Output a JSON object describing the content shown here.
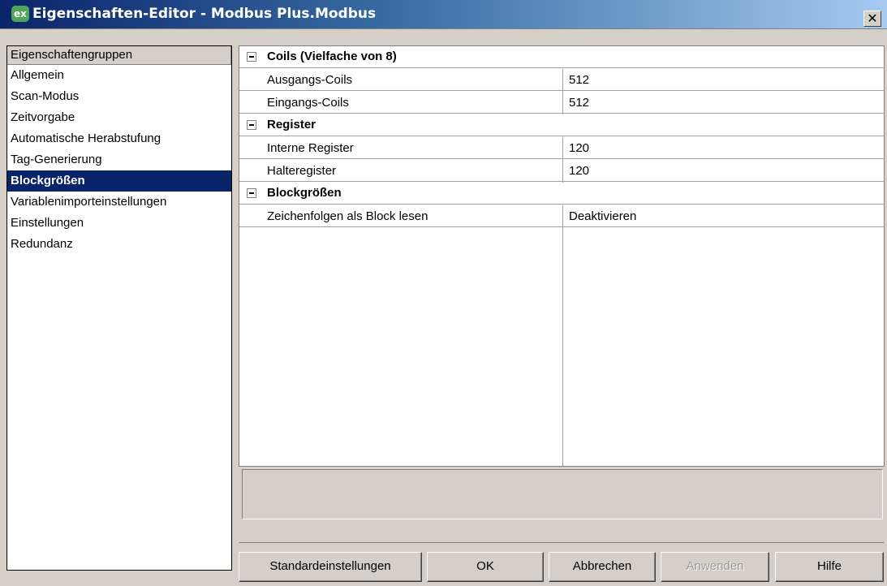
{
  "window": {
    "icon_text": "ex",
    "title": "Eigenschaften-Editor - Modbus Plus.Modbus",
    "close_symbol": "✕"
  },
  "groups": {
    "header": "Eigenschaftengruppen",
    "items": [
      {
        "label": "Allgemein"
      },
      {
        "label": "Scan-Modus"
      },
      {
        "label": "Zeitvorgabe"
      },
      {
        "label": "Automatische Herabstufung"
      },
      {
        "label": "Tag-Generierung"
      },
      {
        "label": "Blockgrößen"
      },
      {
        "label": "Variablenimporteinstellungen"
      },
      {
        "label": "Einstellungen"
      },
      {
        "label": "Redundanz"
      }
    ],
    "selected": "Blockgrößen"
  },
  "grid": {
    "categories": [
      {
        "label": "Coils (Vielfache von 8)",
        "properties": [
          {
            "name": "Ausgangs-Coils",
            "value": "512"
          },
          {
            "name": "Eingangs-Coils",
            "value": "512"
          }
        ]
      },
      {
        "label": "Register",
        "properties": [
          {
            "name": "Interne Register",
            "value": "120"
          },
          {
            "name": "Halteregister",
            "value": "120"
          }
        ]
      },
      {
        "label": "Blockgrößen",
        "properties": [
          {
            "name": "Zeichenfolgen als Block lesen",
            "value": "Deaktivieren"
          }
        ]
      }
    ]
  },
  "buttons": {
    "defaults": "Standardeinstellungen",
    "ok": "OK",
    "cancel": "Abbrechen",
    "apply": "Anwenden",
    "help": "Hilfe"
  },
  "colors": {
    "selection": "#0a246a",
    "dialog_bg": "#d4d0c8"
  }
}
